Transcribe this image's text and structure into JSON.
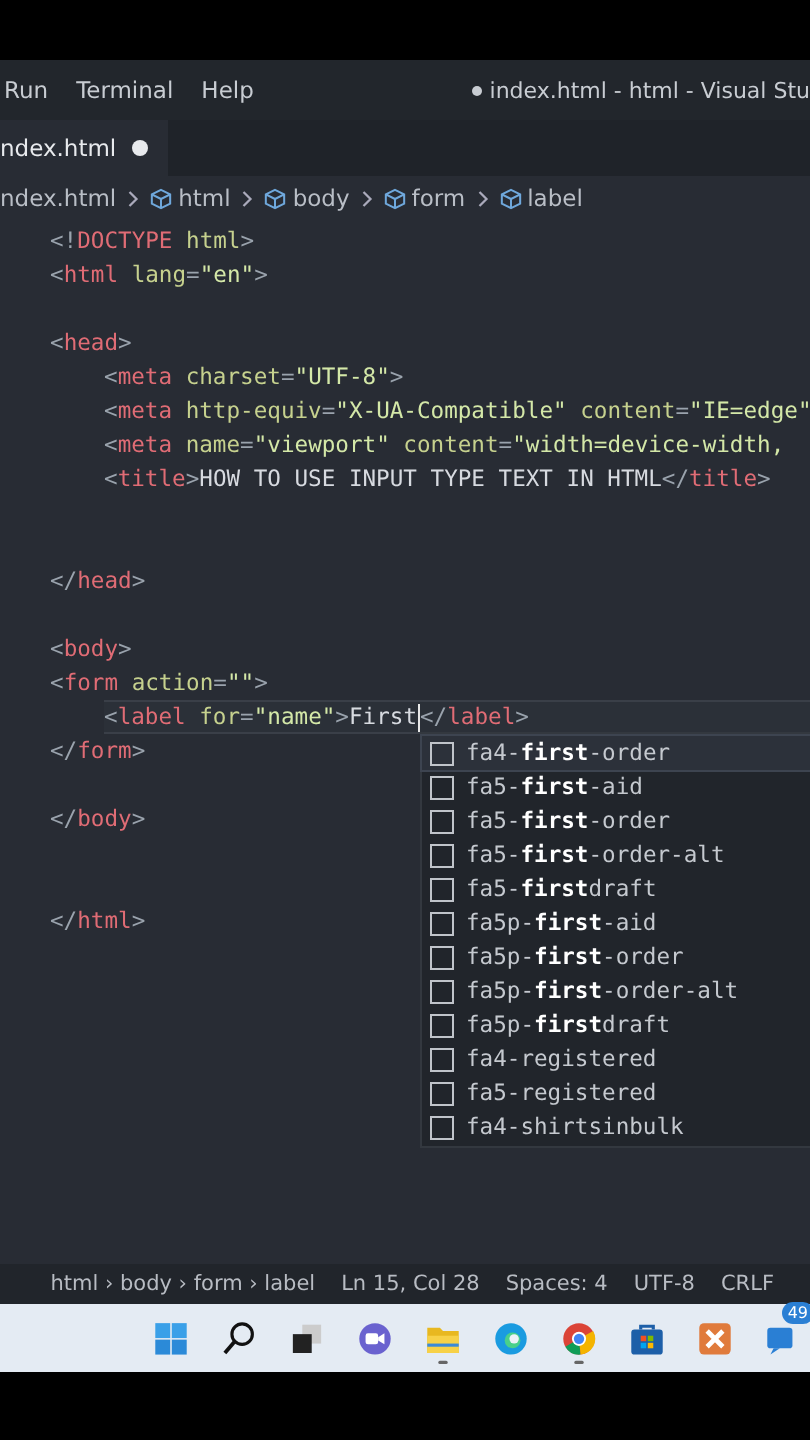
{
  "menu": [
    "Run",
    "Terminal",
    "Help"
  ],
  "window": {
    "title": "index.html - html - Visual Stu",
    "dirty": true
  },
  "tabs": [
    {
      "label": "ndex.html",
      "selected": true,
      "dirty": true
    }
  ],
  "breadcrumb": [
    "ndex.html",
    "html",
    "body",
    "form",
    "label"
  ],
  "code": [
    {
      "kind": "code",
      "current": false,
      "tokens": [
        {
          "kind": "p",
          "t": "<!"
        },
        {
          "kind": "tag",
          "t": "DOCTYPE"
        },
        {
          "kind": "attr",
          "t": " html"
        },
        {
          "kind": "p",
          "t": ">"
        }
      ]
    },
    {
      "kind": "code",
      "current": false,
      "tokens": [
        {
          "kind": "p",
          "t": "<"
        },
        {
          "kind": "tag",
          "t": "html"
        },
        {
          "kind": "attr",
          "t": " lang"
        },
        {
          "kind": "p",
          "t": "="
        },
        {
          "kind": "str",
          "t": "\"en\""
        },
        {
          "kind": "p",
          "t": ">"
        }
      ]
    },
    {
      "kind": "blank"
    },
    {
      "kind": "code",
      "current": false,
      "tokens": [
        {
          "kind": "p",
          "t": "<"
        },
        {
          "kind": "tag",
          "t": "head"
        },
        {
          "kind": "p",
          "t": ">"
        }
      ],
      "children": [
        {
          "kind": "code",
          "current": false,
          "tokens": [
            {
              "kind": "p",
              "t": "<"
            },
            {
              "kind": "tag",
              "t": "meta"
            },
            {
              "kind": "attr",
              "t": " charset"
            },
            {
              "kind": "p",
              "t": "="
            },
            {
              "kind": "str",
              "t": "\"UTF-8\""
            },
            {
              "kind": "p",
              "t": ">"
            }
          ]
        },
        {
          "kind": "code",
          "current": false,
          "tokens": [
            {
              "kind": "p",
              "t": "<"
            },
            {
              "kind": "tag",
              "t": "meta"
            },
            {
              "kind": "attr",
              "t": " http-equiv"
            },
            {
              "kind": "p",
              "t": "="
            },
            {
              "kind": "str",
              "t": "\"X-UA-Compatible\""
            },
            {
              "kind": "attr",
              "t": " content"
            },
            {
              "kind": "p",
              "t": "="
            },
            {
              "kind": "str",
              "t": "\"IE=edge\""
            }
          ]
        },
        {
          "kind": "code",
          "current": false,
          "tokens": [
            {
              "kind": "p",
              "t": "<"
            },
            {
              "kind": "tag",
              "t": "meta"
            },
            {
              "kind": "attr",
              "t": " name"
            },
            {
              "kind": "p",
              "t": "="
            },
            {
              "kind": "str",
              "t": "\"viewport\""
            },
            {
              "kind": "attr",
              "t": " content"
            },
            {
              "kind": "p",
              "t": "="
            },
            {
              "kind": "str",
              "t": "\"width=device-width,"
            }
          ]
        },
        {
          "kind": "code",
          "current": false,
          "tokens": [
            {
              "kind": "p",
              "t": "<"
            },
            {
              "kind": "tag",
              "t": "title"
            },
            {
              "kind": "p",
              "t": ">"
            },
            {
              "kind": "text",
              "t": "HOW TO USE INPUT TYPE TEXT IN HTML"
            },
            {
              "kind": "p",
              "t": "</"
            },
            {
              "kind": "tag",
              "t": "title"
            },
            {
              "kind": "p",
              "t": ">"
            }
          ]
        },
        {
          "kind": "blank"
        },
        {
          "kind": "blank"
        }
      ]
    },
    {
      "kind": "code",
      "current": false,
      "tokens": [
        {
          "kind": "p",
          "t": "</"
        },
        {
          "kind": "tag",
          "t": "head"
        },
        {
          "kind": "p",
          "t": ">"
        }
      ]
    },
    {
      "kind": "blank"
    },
    {
      "kind": "code",
      "current": false,
      "tokens": [
        {
          "kind": "p",
          "t": "<"
        },
        {
          "kind": "tag",
          "t": "body"
        },
        {
          "kind": "p",
          "t": ">"
        }
      ]
    },
    {
      "kind": "code",
      "current": false,
      "tokens": [
        {
          "kind": "p",
          "t": "<"
        },
        {
          "kind": "tag",
          "t": "form"
        },
        {
          "kind": "attr",
          "t": " action"
        },
        {
          "kind": "p",
          "t": "="
        },
        {
          "kind": "str",
          "t": "\"\""
        },
        {
          "kind": "p",
          "t": ">"
        }
      ],
      "children": [
        {
          "kind": "code",
          "current": true,
          "tokens": [
            {
              "kind": "p",
              "t": "<"
            },
            {
              "kind": "tag",
              "t": "label"
            },
            {
              "kind": "attr",
              "t": " for"
            },
            {
              "kind": "p",
              "t": "="
            },
            {
              "kind": "str",
              "t": "\"name\""
            },
            {
              "kind": "p",
              "t": ">"
            },
            {
              "kind": "text",
              "t": "First"
            },
            {
              "kind": "cursor"
            },
            {
              "kind": "p",
              "t": "</"
            },
            {
              "kind": "tag",
              "t": "label"
            },
            {
              "kind": "p",
              "t": ">"
            }
          ]
        }
      ]
    },
    {
      "kind": "code",
      "current": false,
      "tokens": [
        {
          "kind": "p",
          "t": "</"
        },
        {
          "kind": "tag",
          "t": "form"
        },
        {
          "kind": "p",
          "t": ">"
        }
      ]
    },
    {
      "kind": "blank"
    },
    {
      "kind": "code",
      "current": false,
      "tokens": [
        {
          "kind": "p",
          "t": "</"
        },
        {
          "kind": "tag",
          "t": "body"
        },
        {
          "kind": "p",
          "t": ">"
        }
      ]
    },
    {
      "kind": "blank"
    },
    {
      "kind": "blank"
    },
    {
      "kind": "code",
      "current": false,
      "tokens": [
        {
          "kind": "p",
          "t": "</"
        },
        {
          "kind": "tag",
          "t": "html"
        },
        {
          "kind": "p",
          "t": ">"
        }
      ]
    }
  ],
  "suggestions": [
    {
      "label": "fa4-**first**-order",
      "selected": true
    },
    {
      "label": "fa5-**first**-aid",
      "selected": false
    },
    {
      "label": "fa5-**first**-order",
      "selected": false
    },
    {
      "label": "fa5-**first**-order-alt",
      "selected": false
    },
    {
      "label": "fa5-**first**draft",
      "selected": false
    },
    {
      "label": "fa5p-**first**-aid",
      "selected": false
    },
    {
      "label": "fa5p-**first**-order",
      "selected": false
    },
    {
      "label": "fa5p-**first**-order-alt",
      "selected": false
    },
    {
      "label": "fa5p-**first**draft",
      "selected": false
    },
    {
      "label": "fa4-registered",
      "selected": false
    },
    {
      "label": "fa5-registered",
      "selected": false
    },
    {
      "label": "fa4-shirtsinbulk",
      "selected": false
    }
  ],
  "status_bar": [
    "html › body › form › label",
    "Ln 15, Col 28",
    "Spaces: 4",
    "UTF-8",
    "CRLF"
  ],
  "taskbar": [
    {
      "kind": "start",
      "running": false
    },
    {
      "kind": "search",
      "running": false
    },
    {
      "kind": "taskview",
      "running": false
    },
    {
      "kind": "teams",
      "running": false
    },
    {
      "kind": "folder",
      "running": true
    },
    {
      "kind": "edge",
      "running": false
    },
    {
      "kind": "chrome",
      "running": true
    },
    {
      "kind": "store",
      "running": false
    },
    {
      "kind": "xampp",
      "running": false
    },
    {
      "kind": "chat",
      "running": false,
      "badge": "49"
    }
  ]
}
